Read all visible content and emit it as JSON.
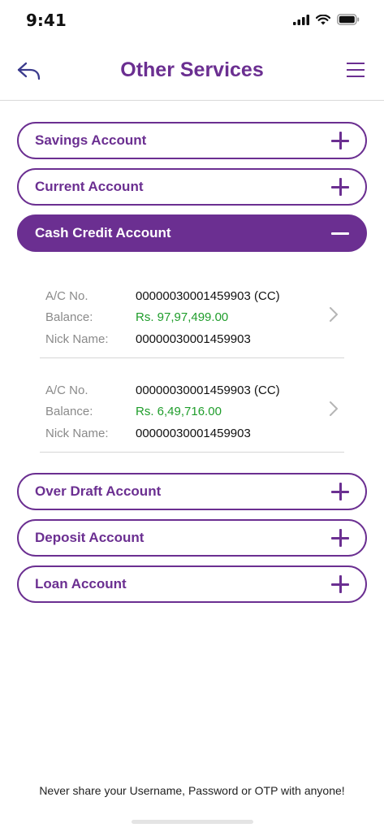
{
  "status_bar": {
    "time": "9:41"
  },
  "header": {
    "title": "Other Services"
  },
  "accordion": [
    {
      "label": "Savings Account",
      "expanded": false
    },
    {
      "label": "Current Account",
      "expanded": false
    },
    {
      "label": "Cash Credit Account",
      "expanded": true
    },
    {
      "label": "Over Draft Account",
      "expanded": false
    },
    {
      "label": "Deposit Account",
      "expanded": false
    },
    {
      "label": "Loan Account",
      "expanded": false
    }
  ],
  "labels": {
    "ac_no": "A/C No.",
    "balance": "Balance:",
    "nick_name": "Nick Name:"
  },
  "cash_credit_accounts": [
    {
      "ac_no": "00000030001459903 (CC)",
      "balance": "Rs. 97,97,499.00",
      "nick_name": "00000030001459903"
    },
    {
      "ac_no": "00000030001459903 (CC)",
      "balance": "Rs. 6,49,716.00",
      "nick_name": "00000030001459903"
    }
  ],
  "footer": {
    "note": "Never share your Username, Password or OTP with anyone!"
  },
  "colors": {
    "brand": "#6b2f91",
    "money": "#1f9d2b"
  }
}
